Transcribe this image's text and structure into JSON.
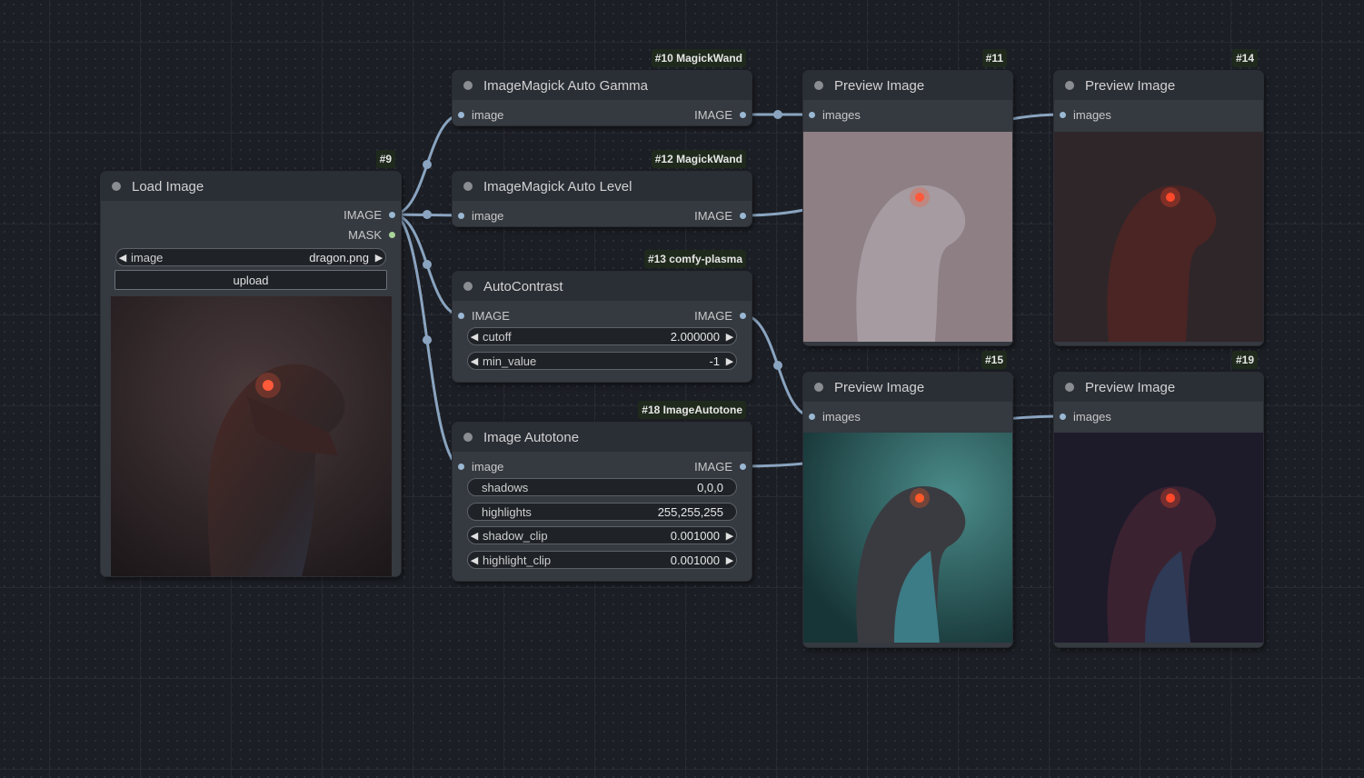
{
  "nodes": {
    "load": {
      "badge": "#9",
      "title": "Load Image",
      "out_image": "IMAGE",
      "out_mask": "MASK",
      "combo_label": "image",
      "combo_value": "dragon.png",
      "upload_label": "upload"
    },
    "gamma": {
      "badge": "#10 MagickWand",
      "title": "ImageMagick Auto Gamma",
      "in": "image",
      "out": "IMAGE"
    },
    "level": {
      "badge": "#12 MagickWand",
      "title": "ImageMagick Auto Level",
      "in": "image",
      "out": "IMAGE"
    },
    "contrast": {
      "badge": "#13 comfy-plasma",
      "title": "AutoContrast",
      "in": "IMAGE",
      "out": "IMAGE",
      "widgets": [
        {
          "label": "cutoff",
          "value": "2.000000"
        },
        {
          "label": "min_value",
          "value": "-1"
        }
      ]
    },
    "autotone": {
      "badge": "#18 ImageAutotone",
      "title": "Image Autotone",
      "in": "image",
      "out": "IMAGE",
      "widgets": [
        {
          "label": "shadows",
          "value": "0,0,0"
        },
        {
          "label": "highlights",
          "value": "255,255,255"
        },
        {
          "label": "shadow_clip",
          "value": "0.001000"
        },
        {
          "label": "highlight_clip",
          "value": "0.001000"
        }
      ]
    },
    "p11": {
      "badge": "#11",
      "title": "Preview Image",
      "in": "images"
    },
    "p14": {
      "badge": "#14",
      "title": "Preview Image",
      "in": "images"
    },
    "p15": {
      "badge": "#15",
      "title": "Preview Image",
      "in": "images"
    },
    "p19": {
      "badge": "#19",
      "title": "Preview Image",
      "in": "images"
    }
  },
  "colors": {
    "link": "#8aa4c0",
    "image_port": "#9ab8d3",
    "mask_port": "#a9d49a",
    "node_bg": "#353940",
    "node_header": "#2a2e35",
    "original_tint": "#3a2c2e",
    "gamma_tint": "#8d7f83",
    "level_tint": "#2f262a",
    "contrast_tint": "#2c5c5e",
    "autotone_tint": "#1d1a2a"
  }
}
